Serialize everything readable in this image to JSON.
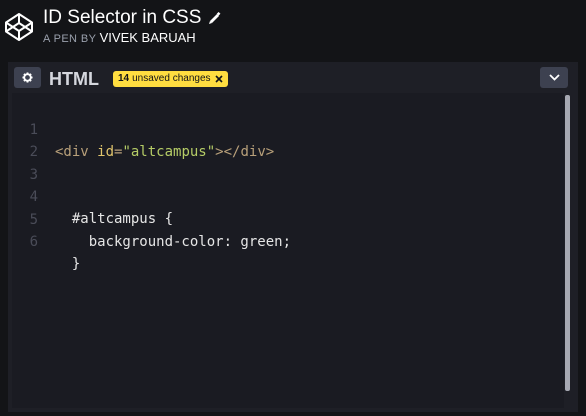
{
  "header": {
    "title": "ID Selector in CSS",
    "byline_prefix": "A PEN BY",
    "author": "VIVEK BARUAH",
    "logo_icon": "codepen-logo-icon",
    "edit_icon": "pencil-icon"
  },
  "editor": {
    "language": "HTML",
    "unsaved_count": "14",
    "unsaved_text": "unsaved changes",
    "settings_icon": "gear-icon",
    "collapse_icon": "chevron-down-icon",
    "lines": [
      {
        "num": "1"
      },
      {
        "num": "2"
      },
      {
        "num": "3"
      },
      {
        "num": "4",
        "text": "  #altcampus {"
      },
      {
        "num": "5",
        "text": "    background-color: green;"
      },
      {
        "num": "6",
        "text": "  }"
      }
    ],
    "line1_tokens": {
      "open_tag": "<div",
      "attr": "id",
      "eq": "=",
      "value": "\"altcampus\"",
      "close": "></div>"
    }
  },
  "colors": {
    "accent_badge": "#ffdd40",
    "background": "#131417",
    "editor_bg": "#1a1b22"
  }
}
